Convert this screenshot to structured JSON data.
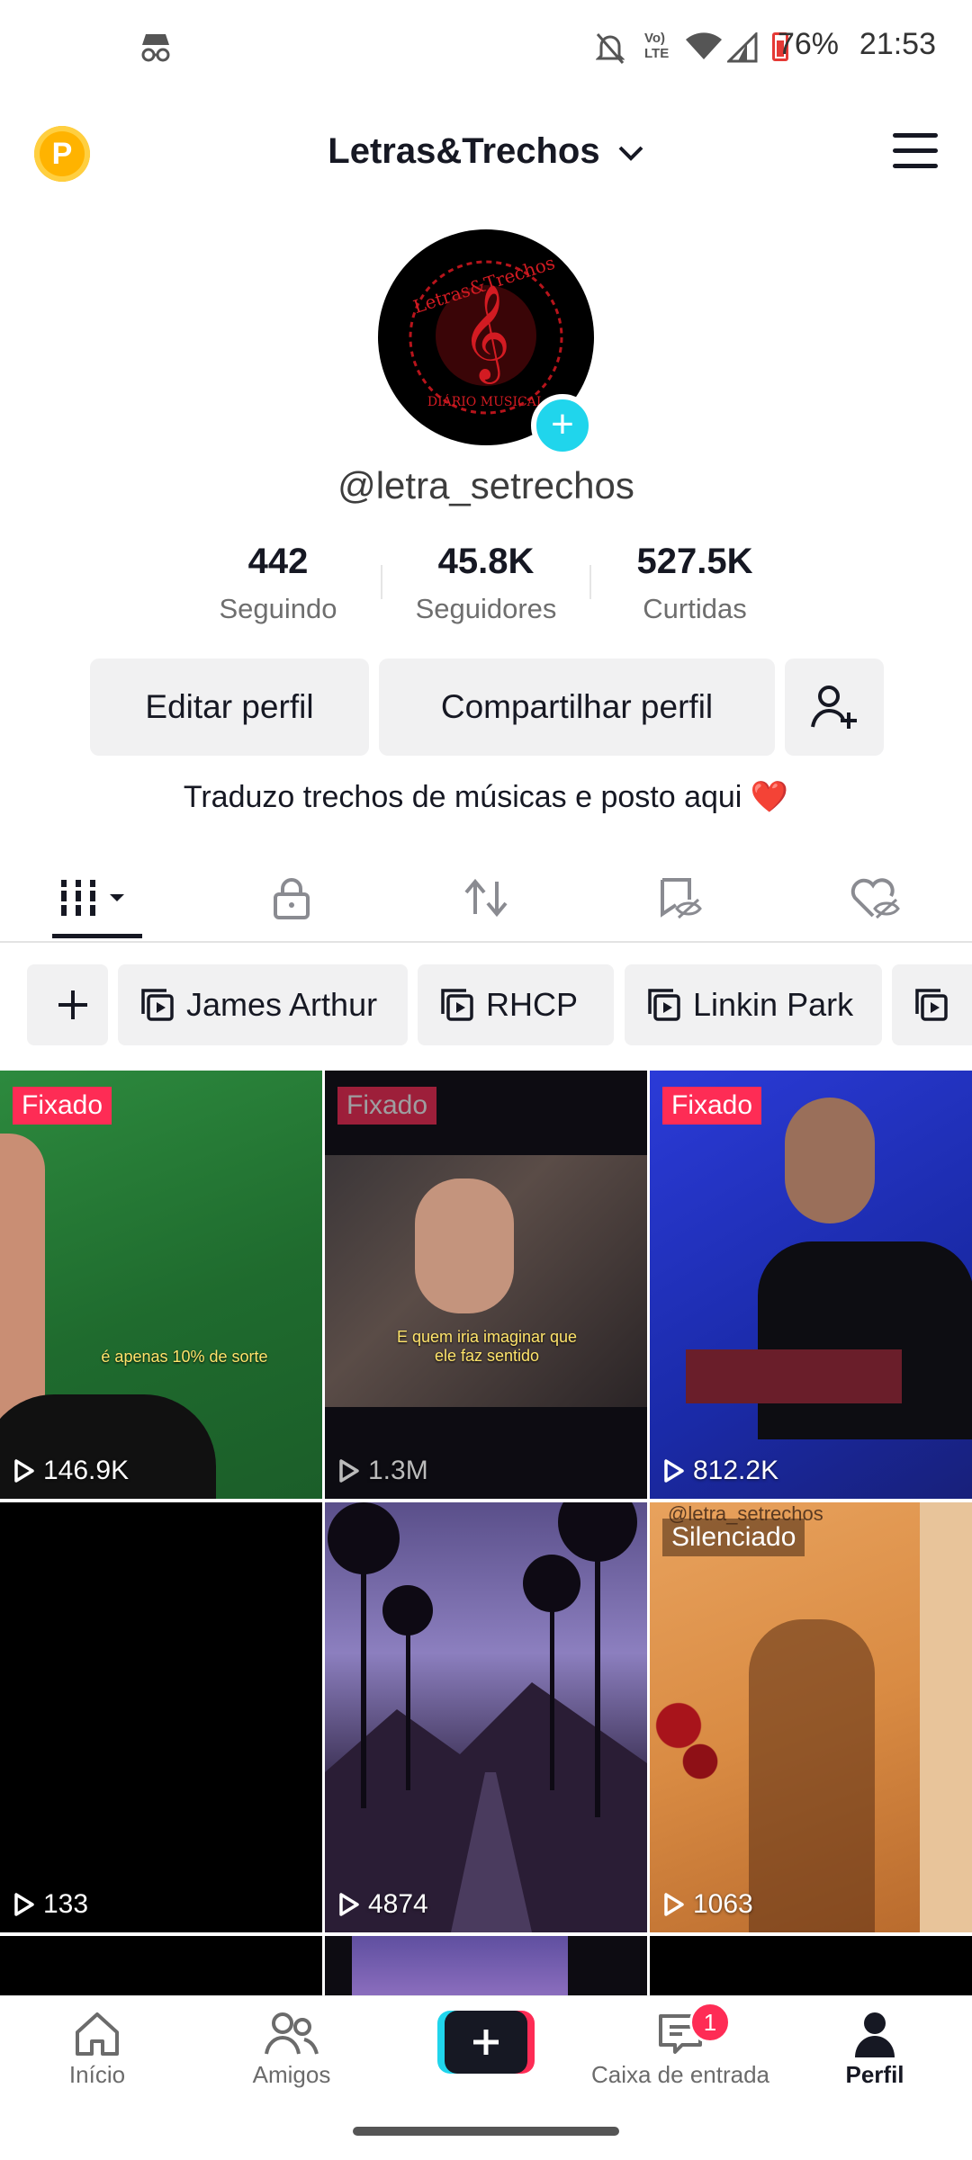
{
  "status_bar": {
    "battery": "76%",
    "time": "21:53"
  },
  "header": {
    "coin_letter": "P",
    "account_name": "Letras&Trechos"
  },
  "profile": {
    "avatar_text_top": "Letras&Trechos",
    "avatar_text_bottom": "DIÁRIO MUSICAL",
    "handle": "@letra_setrechos",
    "stats": [
      {
        "value": "442",
        "label": "Seguindo"
      },
      {
        "value": "45.8K",
        "label": "Seguidores"
      },
      {
        "value": "527.5K",
        "label": "Curtidas"
      }
    ],
    "edit_label": "Editar perfil",
    "share_label": "Compartilhar perfil",
    "bio": "Traduzo trechos de músicas e posto aqui ❤️"
  },
  "playlists": [
    "James Arthur",
    "RHCP",
    "Linkin Park"
  ],
  "videos": [
    {
      "badge": "Fixado",
      "views": "146.9K",
      "caption": "é apenas 10% de sorte"
    },
    {
      "badge": "Fixado",
      "views": "1.3M",
      "caption": "E quem iria imaginar que ele faz sentido"
    },
    {
      "badge": "Fixado",
      "views": "812.2K",
      "caption": ""
    },
    {
      "badge": "",
      "views": "133",
      "caption": ""
    },
    {
      "badge": "",
      "views": "4874",
      "caption": ""
    },
    {
      "badge": "Silenciado",
      "views": "1063",
      "caption": "",
      "watermark": "@letra_setrechos"
    }
  ],
  "bottom_nav": {
    "home": "Início",
    "friends": "Amigos",
    "inbox": "Caixa de entrada",
    "inbox_badge": "1",
    "profile": "Perfil"
  },
  "colors": {
    "accent": "#fe2c55",
    "cyan": "#20d5ec",
    "coin": "#ffb300"
  }
}
